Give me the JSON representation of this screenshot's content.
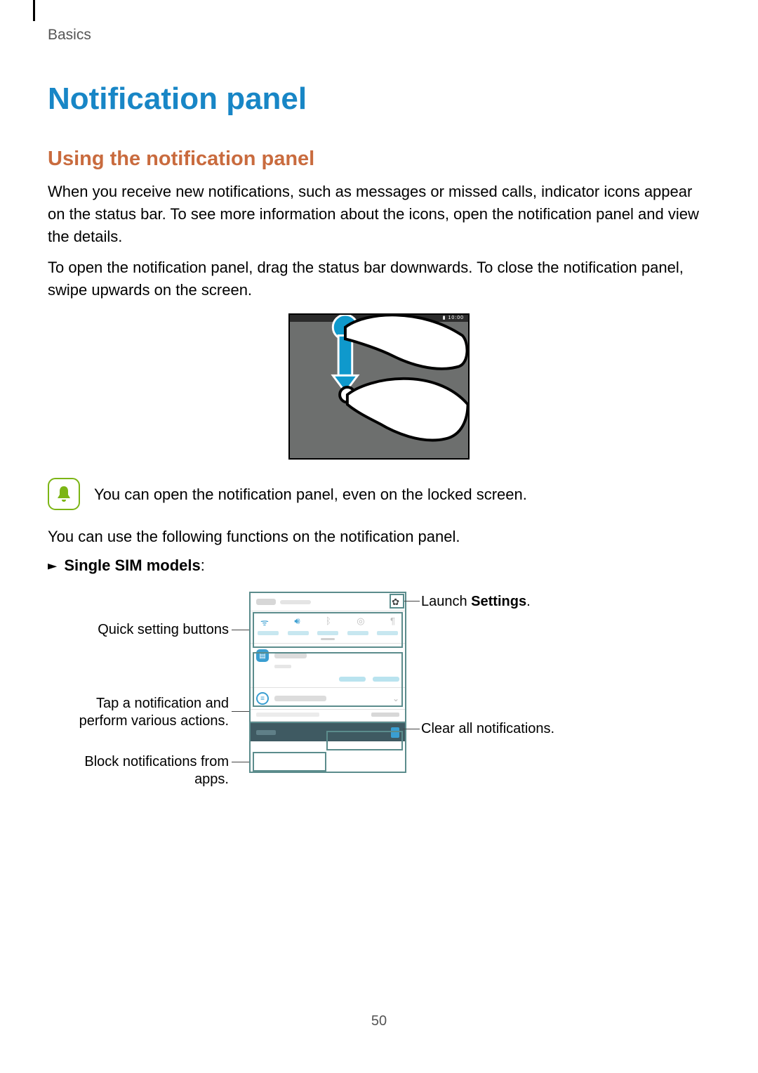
{
  "breadcrumb": "Basics",
  "title": "Notification panel",
  "section": "Using the notification panel",
  "p1": "When you receive new notifications, such as messages or missed calls, indicator icons appear on the status bar. To see more information about the icons, open the notification panel and view the details.",
  "p2": "To open the notification panel, drag the status bar downwards. To close the notification panel, swipe upwards on the screen.",
  "tip": "You can open the notification panel, even on the locked screen.",
  "p3": "You can use the following functions on the notification panel.",
  "sim_prefix": "►",
  "sim_bold": "Single SIM models",
  "sim_suffix": ":",
  "gesture_status_time": "▮ 10:00",
  "callouts": {
    "gear_pre": "Launch ",
    "gear_bold": "Settings",
    "gear_post": ".",
    "quick": "Quick setting buttons",
    "notif": "Tap a notification and perform various actions.",
    "block": "Block notifications from apps.",
    "clear": "Clear all notifications."
  },
  "page_number": "50"
}
